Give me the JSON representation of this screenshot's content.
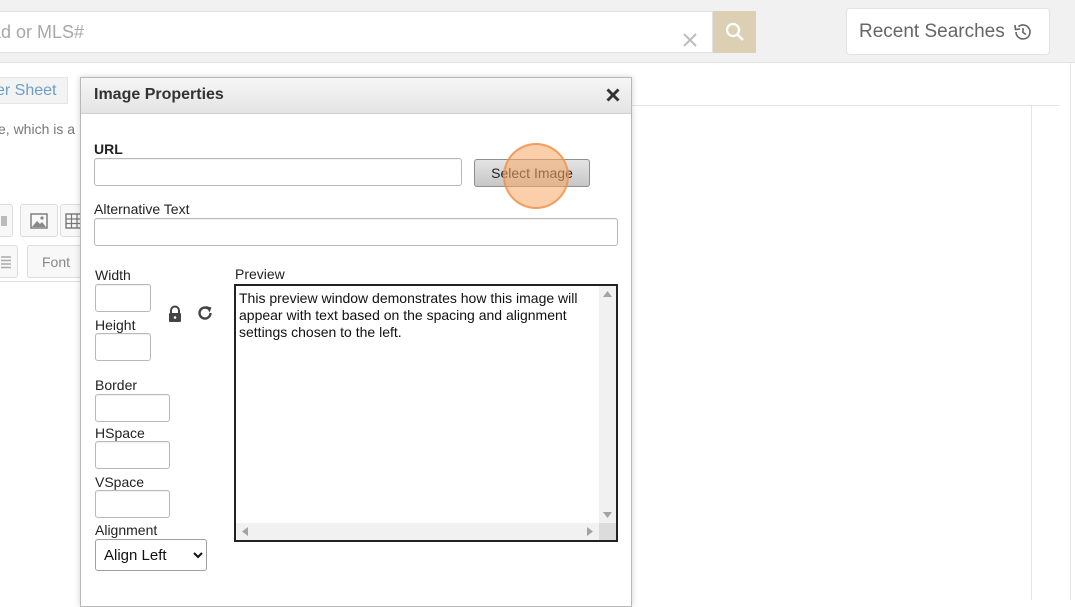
{
  "search": {
    "placeholder": "ad or MLS#"
  },
  "recent": {
    "label": "Recent Searches"
  },
  "tabs": {
    "partial_tab": "er Sheet"
  },
  "description_partial": "e, which is a",
  "toolbar": {
    "font_label": "Font"
  },
  "modal": {
    "title": "Image Properties",
    "url_label": "URL",
    "url_value": "",
    "select_image_label": "Select Image",
    "alt_label": "Alternative Text",
    "alt_value": "",
    "width_label": "Width",
    "height_label": "Height",
    "border_label": "Border",
    "hspace_label": "HSpace",
    "vspace_label": "VSpace",
    "alignment_label": "Alignment",
    "alignment_value": "Align Left",
    "preview_label": "Preview",
    "preview_text": "This preview window demonstrates how this image will appear with text based on the spacing and alignment settings chosen to the left."
  },
  "colors": {
    "search_button": "#dccfb4",
    "link_blue": "#6c9ec8",
    "click_marker": "#f7a863"
  }
}
